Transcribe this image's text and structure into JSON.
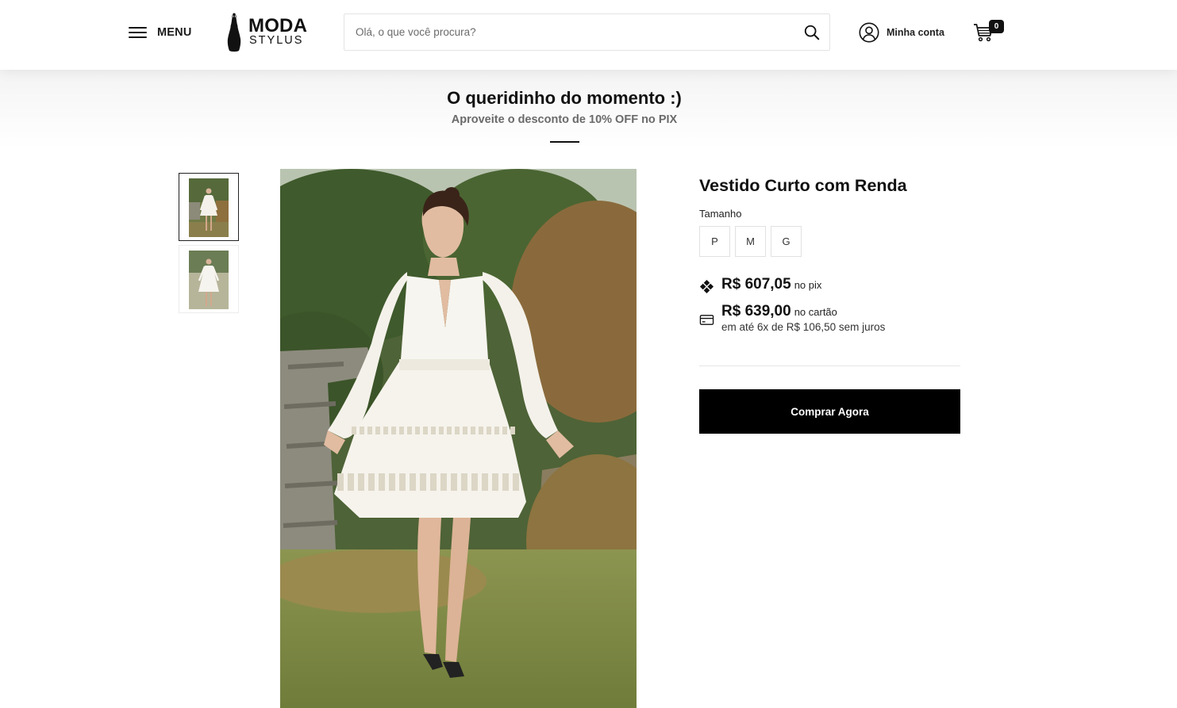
{
  "header": {
    "menu_label": "MENU",
    "logo": {
      "title": "MODA",
      "subtitle": "STYLUS"
    },
    "search": {
      "placeholder": "Olá, o que você procura?",
      "value": ""
    },
    "account_label": "Minha conta",
    "cart_count": "0"
  },
  "promo": {
    "title": "O queridinho do momento :)",
    "subtitle": "Aproveite o desconto de 10% OFF no PIX"
  },
  "gallery": {
    "thumbnails": [
      {
        "name": "thumbnail-1",
        "active": true
      },
      {
        "name": "thumbnail-2",
        "active": false
      }
    ]
  },
  "product": {
    "title": "Vestido Curto com Renda",
    "size_label": "Tamanho",
    "sizes": [
      "P",
      "M",
      "G"
    ],
    "price_pix": {
      "value": "R$ 607,05",
      "suffix": "no pix",
      "icon": "pix-icon"
    },
    "price_card": {
      "value": "R$ 639,00",
      "suffix": "no cartão",
      "installments": "em até 6x de R$ 106,50 sem juros",
      "icon": "credit-card-icon"
    },
    "buy_label": "Comprar Agora"
  },
  "colors": {
    "primary": "#000000",
    "text": "#111111",
    "muted": "#6a6a6a",
    "border": "#e1e1e1"
  }
}
